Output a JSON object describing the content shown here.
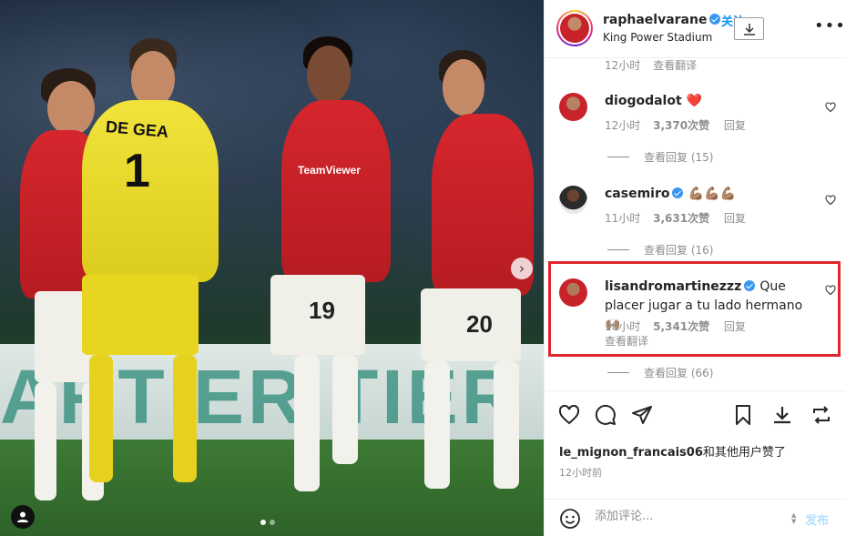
{
  "photo": {
    "shirt_name": "DE GEA",
    "shirt_number_1": "1",
    "shirt_number_19": "19",
    "shirt_number_20": "20",
    "sponsor": "TeamViewer",
    "ad_text": "ARTIER TIER",
    "next_icon": "chevron-right",
    "user_tag_icon": "person-icon"
  },
  "header": {
    "username": "raphaelvarane",
    "follow_label": "关注",
    "location": "King Power Stadium"
  },
  "comments": {
    "top_partial": {
      "time": "12小时",
      "translate": "查看翻译"
    },
    "items": [
      {
        "username": "diogodalot",
        "text": "❤️",
        "time": "12小时",
        "likes": "3,370次赞",
        "reply": "回复",
        "view_replies": "查看回复 (15)"
      },
      {
        "username": "casemiro",
        "text": "💪🏽💪🏽💪🏽",
        "time": "11小时",
        "likes": "3,631次赞",
        "reply": "回复",
        "view_replies": "查看回复 (16)"
      },
      {
        "username": "lisandromartinezzz",
        "text": "Que placer jugar a tu lado hermano 🙌🏽",
        "time": "10小时",
        "likes": "5,341次赞",
        "reply": "回复",
        "translate": "查看翻译",
        "view_replies": "查看回复 (66)"
      }
    ]
  },
  "actions": {
    "liked_by_user": "le_mignon_francais06",
    "liked_by_suffix": "和其他用户赞了",
    "timestamp": "12小时前"
  },
  "add_comment": {
    "placeholder": "添加评论...",
    "post_label": "发布"
  },
  "colors": {
    "accent": "#0095f6",
    "highlight": "#e0252c",
    "heart": "#ed4956",
    "verified": "#3897f0"
  }
}
